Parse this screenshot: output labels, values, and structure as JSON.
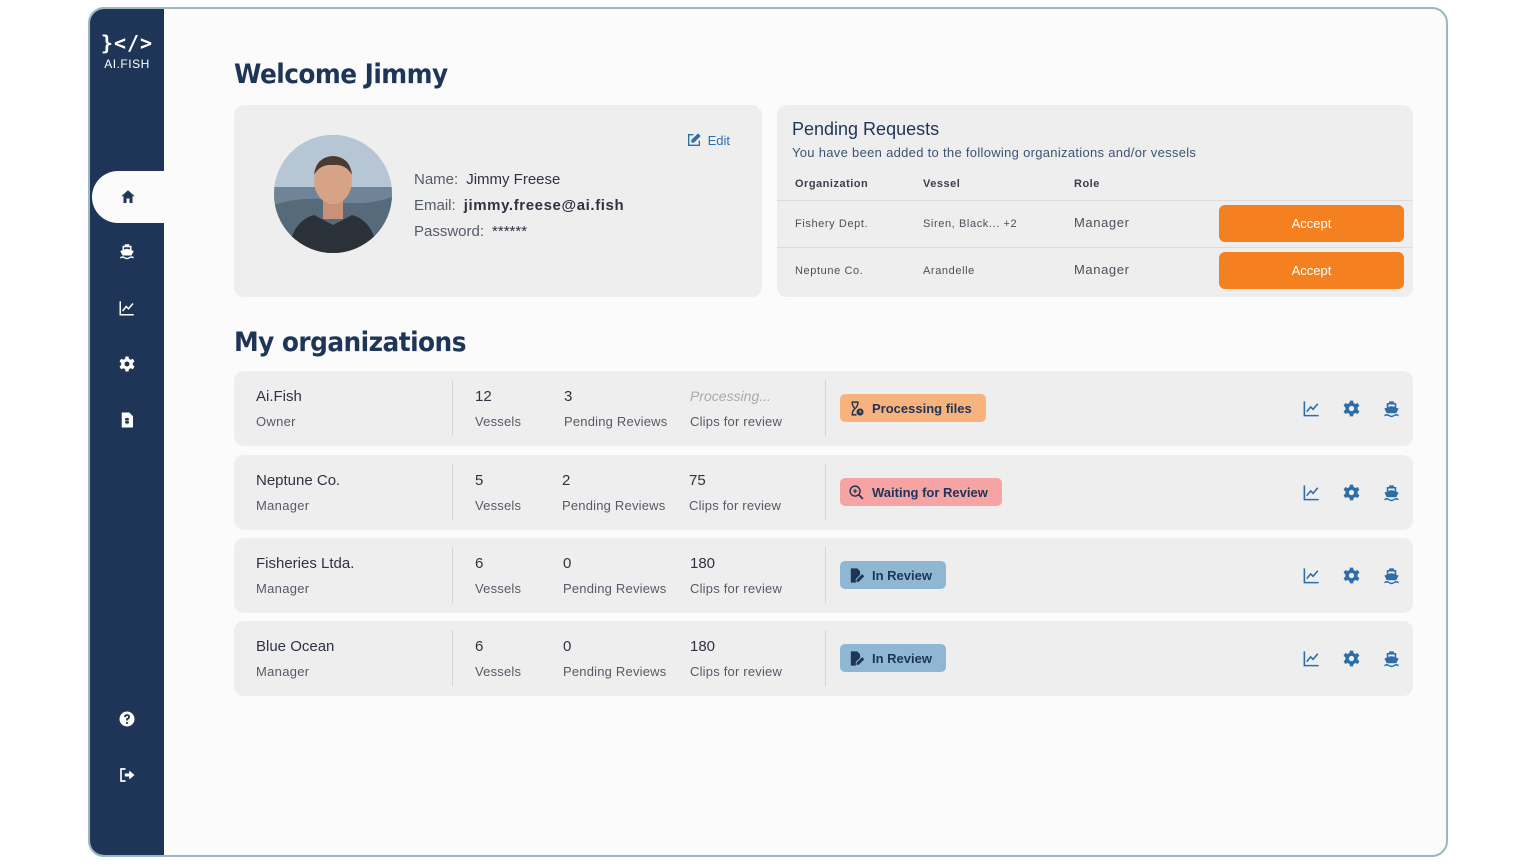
{
  "app": {
    "logo_mark": "}</>",
    "logo_text": "AI.FISH"
  },
  "sidebar": {
    "items": [
      {
        "name": "home-icon",
        "active": true
      },
      {
        "name": "ship-icon",
        "active": false
      },
      {
        "name": "chart-icon",
        "active": false
      },
      {
        "name": "gear-icon",
        "active": false
      },
      {
        "name": "document-icon",
        "active": false
      }
    ],
    "bottom_items": [
      "help-icon",
      "logout-icon"
    ]
  },
  "welcome": {
    "title": "Welcome Jimmy"
  },
  "profile": {
    "edit_label": "Edit",
    "name_label": "Name:",
    "name_value": "Jimmy Freese",
    "email_label": "Email:",
    "email_value": "jimmy.freese@ai.fish",
    "password_label": "Password:",
    "password_value": "******"
  },
  "pending": {
    "title": "Pending Requests",
    "subtitle": "You have been added to the following organizations and/or vessels",
    "columns": [
      "Organization",
      "Vessel",
      "Role"
    ],
    "rows": [
      {
        "organization": "Fishery Dept.",
        "vessel": "Siren, Black... +2",
        "role": "Manager",
        "action": "Accept"
      },
      {
        "organization": "Neptune Co.",
        "vessel": "Arandelle",
        "role": "Manager",
        "action": "Accept"
      }
    ]
  },
  "orgs": {
    "title": "My organizations",
    "rows": [
      {
        "name": "Ai.Fish",
        "role": "Owner",
        "vessels": "12",
        "vessels_label": "Vessels",
        "pending": "3",
        "pending_label": "Pending Reviews",
        "clips": "Processing...",
        "clips_label": "Clips for review",
        "status": "Processing files",
        "status_color": "#f7b27d",
        "status_icon": "hourglass-icon"
      },
      {
        "name": "Neptune Co.",
        "role": "Manager",
        "vessels": "5",
        "vessels_label": "Vessels",
        "pending": "2",
        "pending_label": "Pending Reviews",
        "clips": "75",
        "clips_label": "Clips for review",
        "status": "Waiting for Review",
        "status_color": "#f5a3a3",
        "status_icon": "search-icon"
      },
      {
        "name": "Fisheries Ltda.",
        "role": "Manager",
        "vessels": "6",
        "vessels_label": "Vessels",
        "pending": "0",
        "pending_label": "Pending Reviews",
        "clips": "180",
        "clips_label": "Clips for review",
        "status": "In Review",
        "status_color": "#8fb6d2",
        "status_icon": "edit-document-icon"
      },
      {
        "name": "Blue Ocean",
        "role": "Manager",
        "vessels": "6",
        "vessels_label": "Vessels",
        "pending": "0",
        "pending_label": "Pending Reviews",
        "clips": "180",
        "clips_label": "Clips for review",
        "status": "In Review",
        "status_color": "#8fb6d2",
        "status_icon": "edit-document-icon"
      }
    ],
    "row_actions": [
      "chart-icon",
      "gear-icon",
      "ship-icon"
    ]
  },
  "colors": {
    "sidebar": "#1e3558",
    "accent": "#f5801f",
    "link": "#2e6ea8"
  }
}
